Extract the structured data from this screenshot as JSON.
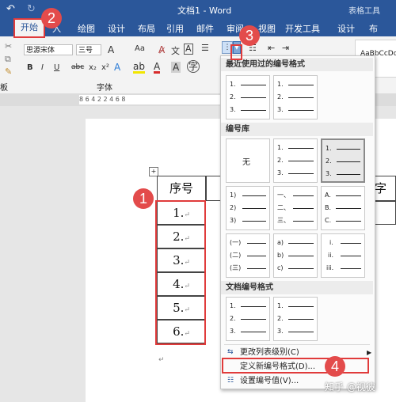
{
  "titlebar": {
    "title": "文档1 - Word",
    "right_tag": "表格工具"
  },
  "tabs": {
    "active": "开始",
    "items": [
      "入",
      "绘图",
      "设计",
      "布局",
      "引用",
      "邮件",
      "审阅",
      "视图",
      "开发工具",
      "设计",
      "布"
    ]
  },
  "ribbon": {
    "font_name": "思源宋体",
    "font_size": "三号",
    "font_group_label": "字体",
    "style_sample": "AaBbCcDc",
    "clipboard_fragment": "板",
    "bold": "B",
    "italic": "I",
    "underline": "U",
    "strike": "abc",
    "sub": "x₂",
    "sup": "x²",
    "grow_font": "A",
    "case": "Aa"
  },
  "ruler": {
    "ticks": "8  6  4  2     2  4  6  8"
  },
  "table": {
    "header": "序号",
    "right_header": "字号",
    "rows": [
      "1.",
      "2.",
      "3.",
      "4.",
      "5.",
      "6."
    ],
    "mark": "↵"
  },
  "menu": {
    "recent_header": "最近使用过的编号格式",
    "library_header": "编号库",
    "doc_header": "文档编号格式",
    "none_label": "无",
    "tiles": {
      "num_dot": [
        "1.",
        "2.",
        "3."
      ],
      "num_paren": [
        "1)",
        "2)",
        "3)"
      ],
      "chinese": [
        "一、",
        "二、",
        "三、"
      ],
      "alpha_upper": [
        "A.",
        "B.",
        "C."
      ],
      "chinese_paren": [
        "(一)",
        "(二)",
        "(三)"
      ],
      "alpha_paren": [
        "a)",
        "b)",
        "c)"
      ],
      "roman_lower": [
        "i.",
        "ii.",
        "iii."
      ]
    },
    "items": [
      {
        "label": "更改列表级别(C)"
      },
      {
        "label": "定义新编号格式(D)..."
      },
      {
        "label": "设置编号值(V)..."
      }
    ]
  },
  "callouts": [
    "1",
    "2",
    "3",
    "4"
  ],
  "watermark": "知乎 @视彼",
  "colors": {
    "brand": "#2b579a",
    "callout": "#e34b4b"
  }
}
